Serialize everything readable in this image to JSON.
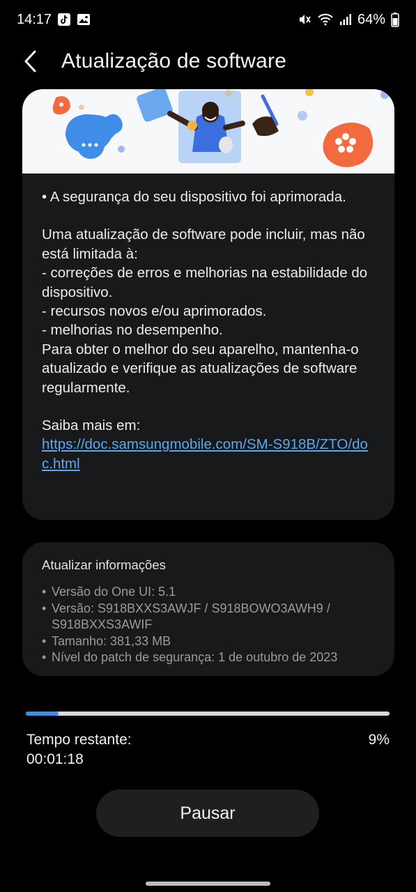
{
  "status_bar": {
    "time": "14:17",
    "battery_percent": "64%",
    "icons": [
      "tiktok-notification-icon",
      "gallery-notification-icon",
      "mute-icon",
      "wifi-icon",
      "signal-icon",
      "battery-icon"
    ]
  },
  "header": {
    "back_icon": "chevron-left-icon",
    "title": "Atualização de software"
  },
  "release_notes": {
    "security_line": "• A segurança do seu dispositivo foi aprimorada.",
    "intro": "Uma atualização de software pode incluir, mas não está limitada à:",
    "items": [
      " - correções de erros e melhorias na estabilidade do dispositivo.",
      " - recursos novos e/ou aprimorados.",
      " - melhorias no desempenho."
    ],
    "advice": "Para obter o melhor do seu aparelho, mantenha-o atualizado e verifique as atualizações de software regularmente.",
    "learn_more_label": "Saiba mais em:",
    "learn_more_link": "https://doc.samsungmobile.com/SM-S918B/ZTO/doc.html"
  },
  "update_info": {
    "title": "Atualizar informações",
    "items": [
      "Versão do One UI: 5.1",
      "Versão: S918BXXS3AWJF / S918BOWO3AWH9 / S918BXXS3AWIF",
      "Tamanho: 381,33 MB",
      "Nível do patch de segurança: 1 de outubro de 2023"
    ]
  },
  "progress": {
    "fraction": 0.09,
    "remaining_label": "Tempo restante:",
    "remaining_time": "00:01:18",
    "percent_label": "9%",
    "fill_color": "#3e8ce6",
    "track_color": "#d8d8d8"
  },
  "actions": {
    "pause_label": "Pausar"
  },
  "colors": {
    "background": "#000000",
    "card": "#17191b",
    "link": "#5aa9f0",
    "banner_background": "#f7f8fa"
  }
}
